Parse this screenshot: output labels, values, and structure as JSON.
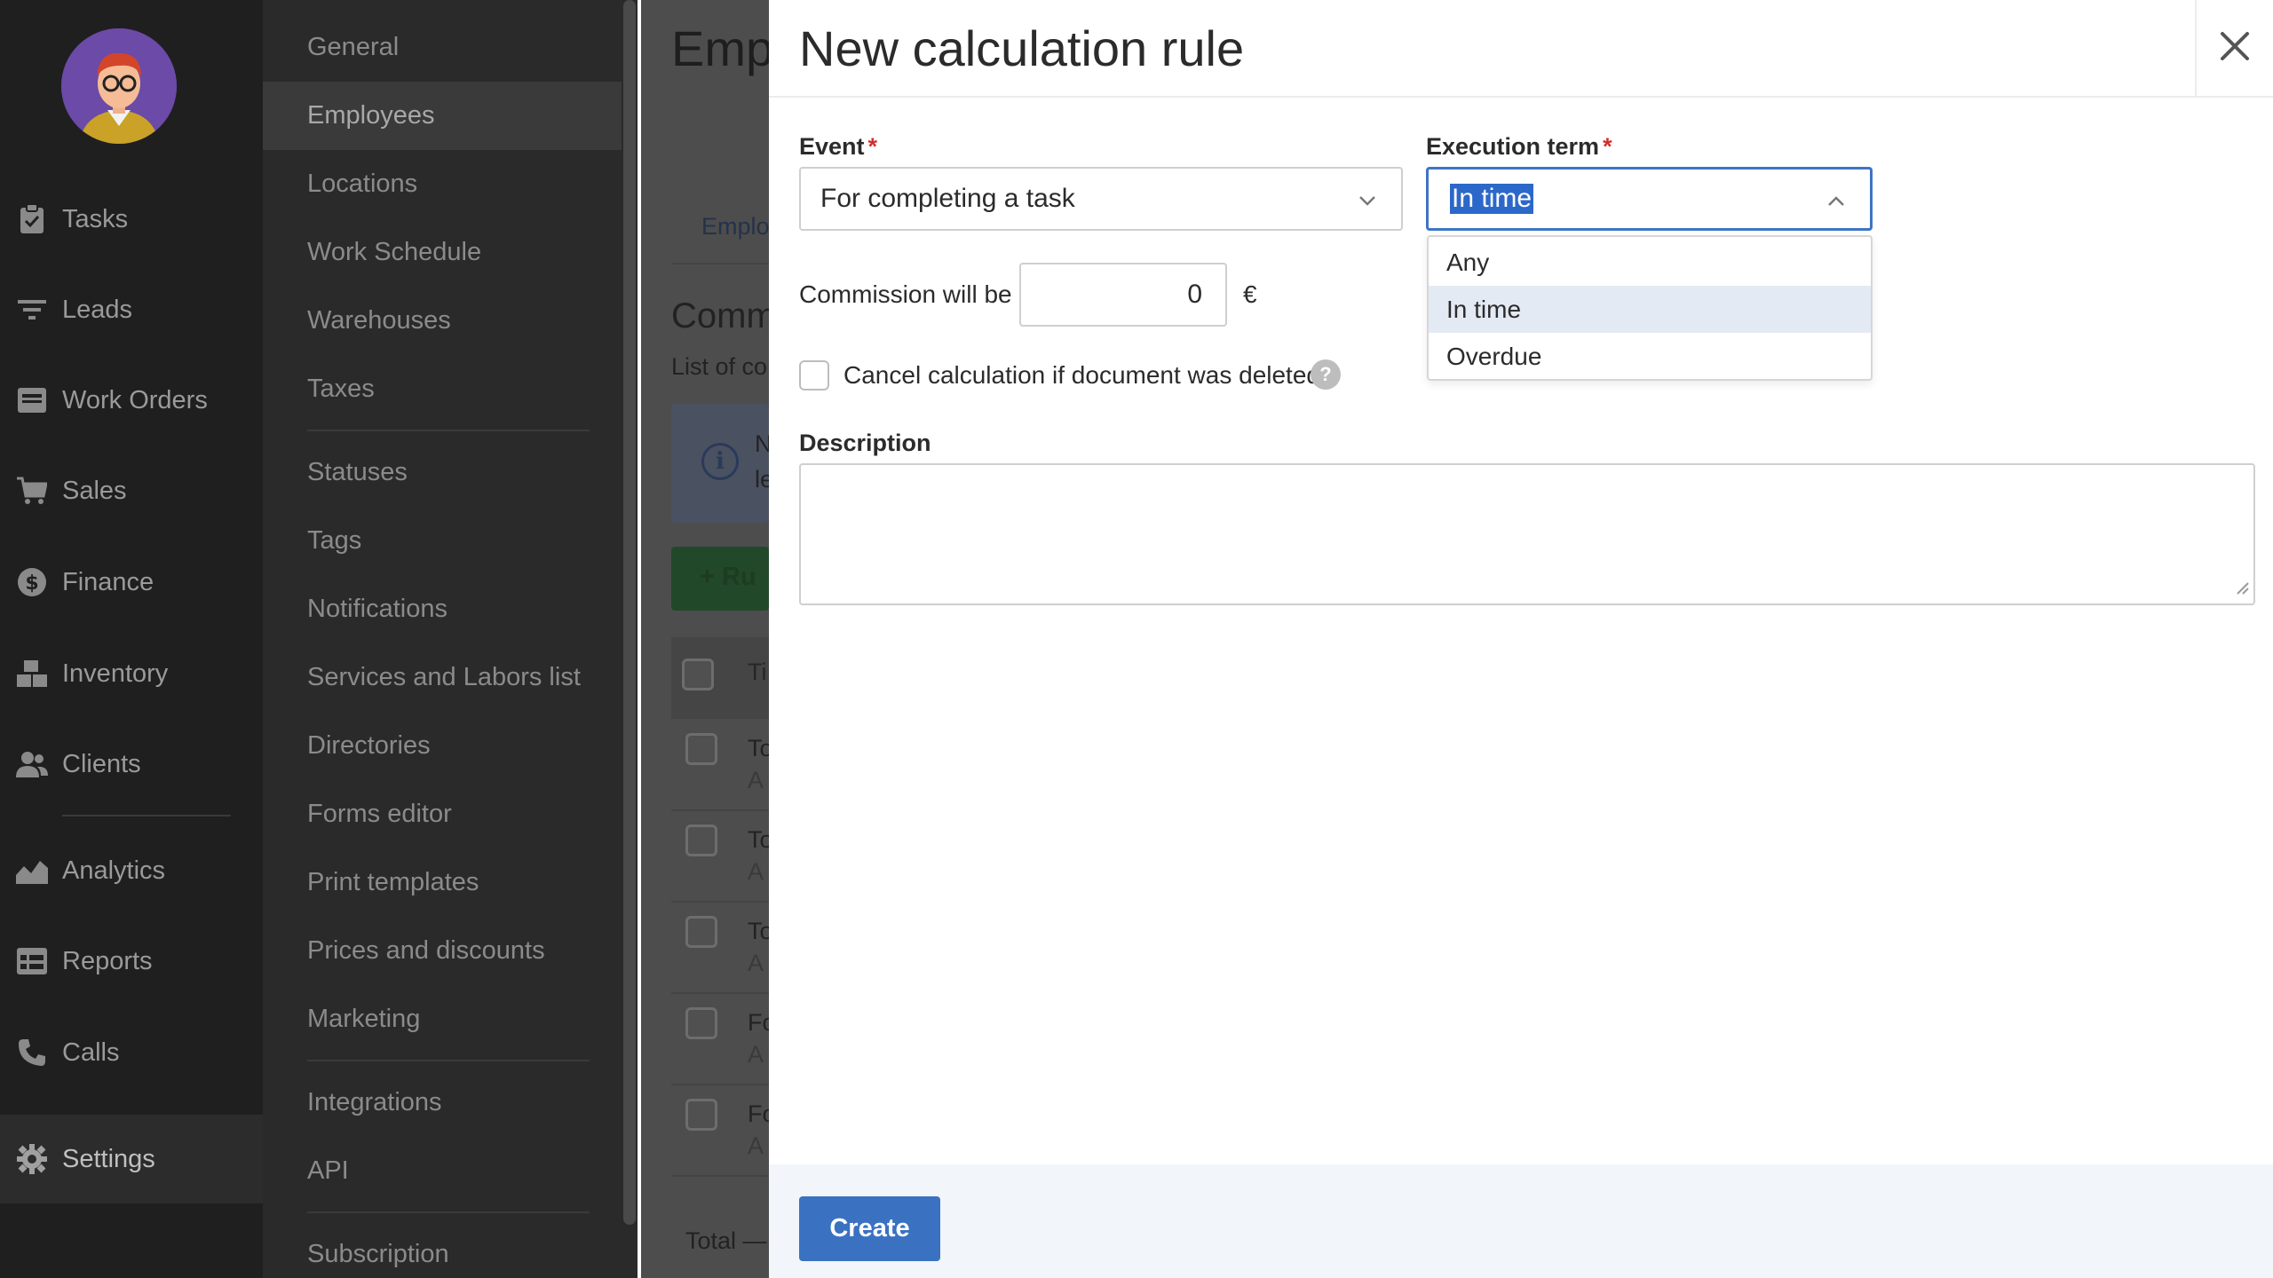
{
  "nav": {
    "items": [
      {
        "label": "Tasks",
        "icon": "clipboard-icon"
      },
      {
        "label": "Leads",
        "icon": "filter-icon"
      },
      {
        "label": "Work Orders",
        "icon": "window-icon"
      },
      {
        "label": "Sales",
        "icon": "cart-icon"
      },
      {
        "label": "Finance",
        "icon": "dollar-icon"
      },
      {
        "label": "Inventory",
        "icon": "boxes-icon"
      },
      {
        "label": "Clients",
        "icon": "people-icon"
      },
      {
        "label": "Analytics",
        "icon": "chart-icon"
      },
      {
        "label": "Reports",
        "icon": "table-icon"
      },
      {
        "label": "Calls",
        "icon": "phone-icon"
      },
      {
        "label": "Settings",
        "icon": "gear-icon"
      }
    ],
    "active": "Settings"
  },
  "settings_menu": {
    "items": [
      "General",
      "Employees",
      "Locations",
      "Work Schedule",
      "Warehouses",
      "Taxes",
      "Statuses",
      "Tags",
      "Notifications",
      "Services and Labors list",
      "Directories",
      "Forms editor",
      "Print templates",
      "Prices and discounts",
      "Marketing",
      "Integrations",
      "API",
      "Subscription"
    ],
    "active": "Employees"
  },
  "background_page": {
    "title_partial": "Emp",
    "tab_partial": "Emplo",
    "section_partial": "Comm",
    "subtitle_partial": "List of co",
    "info_partial_1": "N",
    "info_partial_2": "le",
    "add_button_partial": "+ Ru",
    "header_partial": "Ti",
    "rows": [
      {
        "a": "To",
        "b": "A"
      },
      {
        "a": "To",
        "b": "A"
      },
      {
        "a": "To",
        "b": "A"
      },
      {
        "a": "Fo",
        "b": "A"
      },
      {
        "a": "Fo",
        "b": "A"
      }
    ],
    "total_partial": "Total —"
  },
  "modal": {
    "title": "New calculation rule",
    "close_glyph": "✕",
    "event": {
      "label": "Event",
      "required": "*",
      "value": "For completing a task"
    },
    "execution_term": {
      "label": "Execution term",
      "required": "*",
      "value": "In time",
      "options": [
        "Any",
        "In time",
        "Overdue"
      ],
      "selected_index": 1
    },
    "commission": {
      "label": "Commission will be",
      "value": "0",
      "currency": "€"
    },
    "cancel_checkbox": {
      "label": "Cancel calculation if document was deleted",
      "checked": false,
      "help_glyph": "?"
    },
    "description": {
      "label": "Description",
      "value": ""
    },
    "create_button": "Create"
  },
  "colors": {
    "accent": "#3a72c1",
    "required": "#d32f2f",
    "dropdown_selected": "#e4eaf4",
    "nav_bg": "#1f1f1f"
  }
}
